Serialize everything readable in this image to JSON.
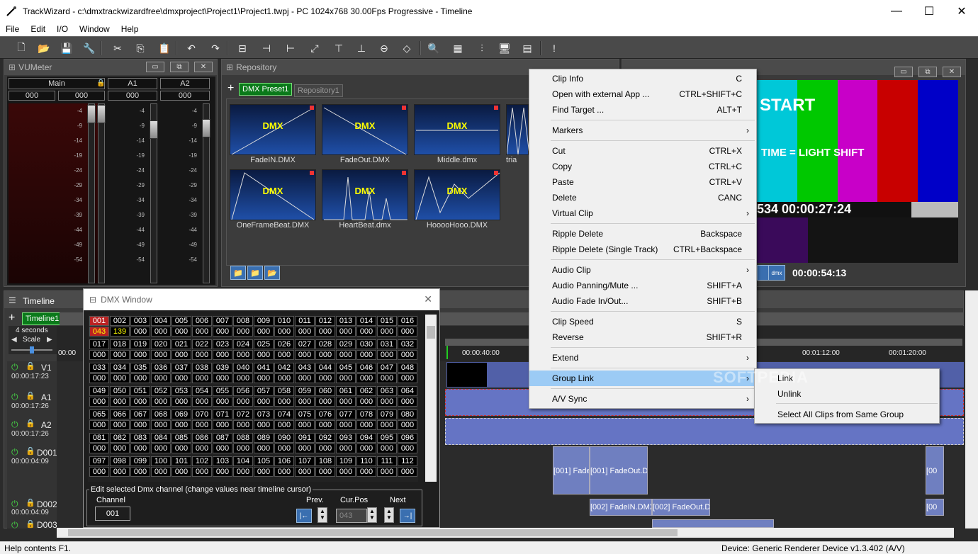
{
  "window": {
    "title": "TrackWizard - c:\\dmxtrackwizardfree\\dmxproject\\Project1\\Project1.twpj - PC 1024x768 30.00Fps Progressive - Timeline",
    "minimize": "—",
    "maximize": "☐",
    "close": "✕"
  },
  "menu": [
    "File",
    "Edit",
    "I/O",
    "Window",
    "Help"
  ],
  "vumeter": {
    "title": "VUMeter",
    "columns": [
      {
        "label": "Main",
        "values": [
          "000",
          "000"
        ]
      },
      {
        "label": "A1",
        "values": [
          "000"
        ]
      },
      {
        "label": "A2",
        "values": [
          "000"
        ]
      }
    ],
    "scale": [
      "-4",
      "-9",
      "-14",
      "-19",
      "-24",
      "-29",
      "-34",
      "-39",
      "-44",
      "-49",
      "-54"
    ],
    "fader_levels": [
      0.45,
      0.42,
      0.35
    ]
  },
  "repository": {
    "title": "Repository",
    "tabs": [
      "DMX Preset1",
      "Repository1"
    ],
    "items": [
      {
        "label": "FadeIN.DMX",
        "text": "DMX"
      },
      {
        "label": "FadeOut.DMX",
        "text": "DMX"
      },
      {
        "label": "Middle.dmx",
        "text": "DMX"
      },
      {
        "label": "tria",
        "text": ""
      },
      {
        "label": "OneFrameBeat.DMX",
        "text": "DMX"
      },
      {
        "label": "HeartBeat.dmx",
        "text": "DMX"
      },
      {
        "label": "HooooHooo.DMX",
        "text": "DMX"
      }
    ]
  },
  "preview": {
    "text_start": "START",
    "text_shift": "TIME = LIGHT SHIFT",
    "timecode": "534 00:00:27:24",
    "position": "00:00:54:13",
    "colors": [
      "#00c8d8",
      "#00c800",
      "#c800c8",
      "#c80000",
      "#0000c8"
    ]
  },
  "timeline": {
    "title": "Timeline",
    "tab": "Timeline1",
    "zoom_label": "4 seconds",
    "scale_label": "Scale",
    "ruler": [
      "00:00",
      "00:00:40:00",
      "00:01:12:00",
      "00:01:20:00"
    ],
    "tracks": [
      {
        "name": "V1",
        "time": "00:00:17:23"
      },
      {
        "name": "A1",
        "time": "00:00:17:26"
      },
      {
        "name": "A2",
        "time": "00:00:17:26"
      },
      {
        "name": "D001",
        "time": "00:00:04:09"
      },
      {
        "name": "D002",
        "time": "00:00:04:09"
      },
      {
        "name": "D003",
        "time": ""
      }
    ],
    "clips": {
      "d001_a": "[001]  Fade",
      "d001_b": "[001]  FadeOut.D",
      "d002_a": "[002]  FadeIN.DMX",
      "d002_b": "[002]  FadeOut.D",
      "d001_c": "[00",
      "d002_c": "[00"
    }
  },
  "dmx_window": {
    "title": "DMX Window",
    "channels_first": [
      "001",
      "002",
      "003",
      "004",
      "005",
      "006",
      "007",
      "008",
      "009",
      "010",
      "011",
      "012",
      "013",
      "014",
      "015",
      "016"
    ],
    "values_first": [
      "043",
      "139",
      "000",
      "000",
      "000",
      "000",
      "000",
      "000",
      "000",
      "000",
      "000",
      "000",
      "000",
      "000",
      "000",
      "000"
    ],
    "row_starts": [
      17,
      33,
      49,
      65,
      81,
      97
    ],
    "edit_legend": "Edit selected Dmx channel (change values near timeline cursor)",
    "channel_label": "Channel",
    "channel_value": "001",
    "prev_label": "Prev.",
    "curpos_label": "Cur.Pos",
    "curpos_value": "043",
    "next_label": "Next"
  },
  "context_menu": {
    "items": [
      {
        "label": "Clip Info",
        "shortcut": "C"
      },
      {
        "label": "Open with external App ...",
        "shortcut": "CTRL+SHIFT+C"
      },
      {
        "label": "Find Target ...",
        "shortcut": "ALT+T"
      },
      {
        "label": "Markers",
        "shortcut": "",
        "sub": true
      },
      {
        "label": "Cut",
        "shortcut": "CTRL+X"
      },
      {
        "label": "Copy",
        "shortcut": "CTRL+C"
      },
      {
        "label": "Paste",
        "shortcut": "CTRL+V"
      },
      {
        "label": "Delete",
        "shortcut": "CANC"
      },
      {
        "label": "Virtual Clip",
        "shortcut": "",
        "sub": true
      },
      {
        "label": "Ripple Delete",
        "shortcut": "Backspace"
      },
      {
        "label": "Ripple Delete (Single Track)",
        "shortcut": "CTRL+Backspace"
      },
      {
        "label": "Audio Clip",
        "shortcut": "",
        "sub": true
      },
      {
        "label": "Audio Panning/Mute ...",
        "shortcut": "SHIFT+A"
      },
      {
        "label": "Audio Fade In/Out...",
        "shortcut": "SHIFT+B"
      },
      {
        "label": "Clip Speed",
        "shortcut": "S"
      },
      {
        "label": "Reverse",
        "shortcut": "SHIFT+R"
      },
      {
        "label": "Extend",
        "shortcut": "",
        "sub": true
      },
      {
        "label": "Group Link",
        "shortcut": "",
        "sub": true
      },
      {
        "label": "A/V Sync",
        "shortcut": "",
        "sub": true
      }
    ]
  },
  "submenu": {
    "items": [
      "Link",
      "Unlink",
      "Select All Clips from Same Group"
    ]
  },
  "watermark": "SOFTPEDIA",
  "statusbar": {
    "left": "Help contents  F1.",
    "right": "Device: Generic Renderer Device v1.3.402 (A/V)"
  }
}
